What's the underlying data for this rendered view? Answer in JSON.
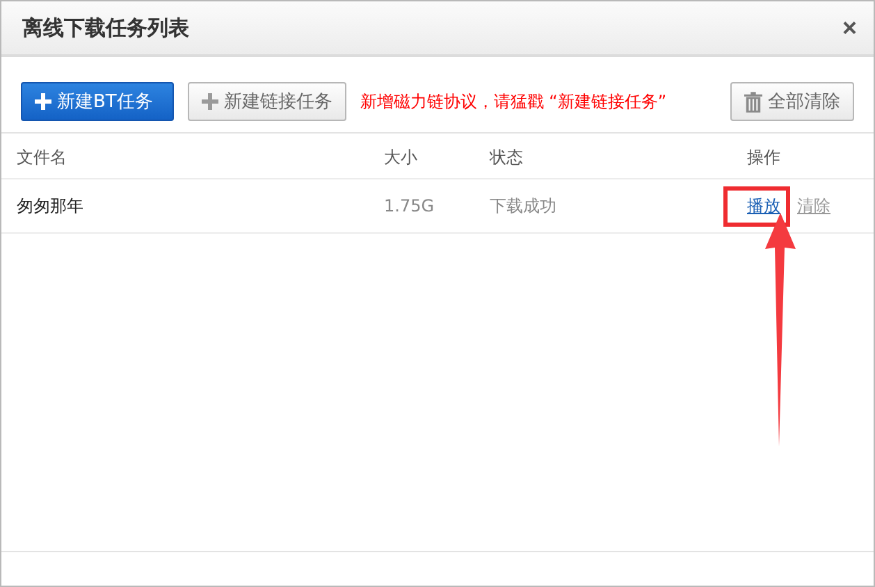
{
  "window": {
    "title": "离线下载任务列表",
    "close": "×"
  },
  "toolbar": {
    "buttons": [
      {
        "kind": "primary",
        "label": "新建BT任务"
      },
      {
        "kind": "secondary",
        "label": "新建链接任务"
      }
    ],
    "notice": "新增磁力链协议，请猛戳 “新建链接任务”",
    "clear_button": "全部清除"
  },
  "table": {
    "columns": [
      "文件名",
      "大小",
      "状态",
      "操作"
    ],
    "rows": [
      {
        "name": "匆匆那年",
        "size": "1.75G",
        "status": "下载成功",
        "actions": [
          {
            "label": "播放",
            "kind": "play",
            "highlighted": true
          },
          {
            "label": "清除",
            "kind": "clear",
            "highlighted": false
          }
        ]
      }
    ]
  }
}
